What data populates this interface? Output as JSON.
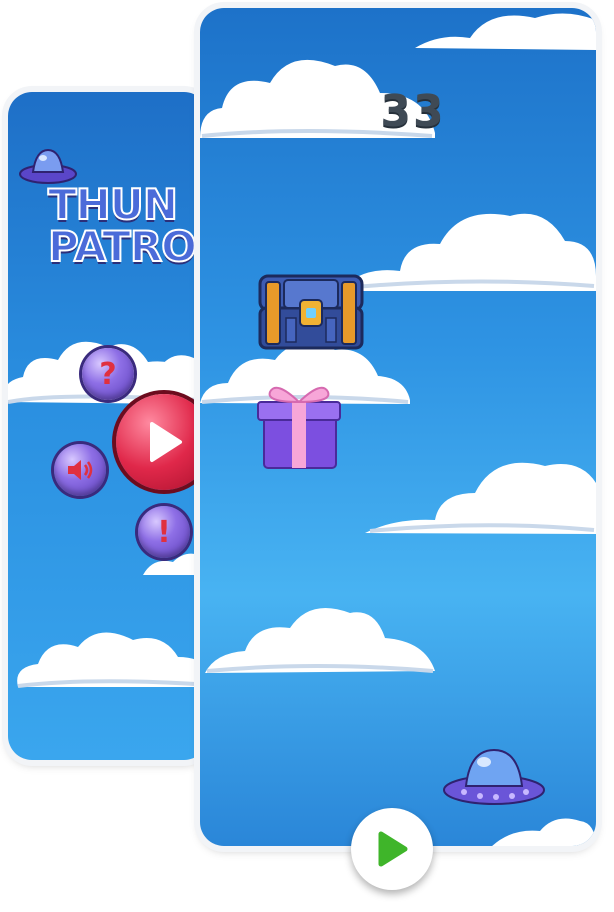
{
  "game": {
    "title_line1": "THUN",
    "title_line2": "PATRO",
    "score": "33"
  },
  "menu": {
    "help_icon": "question-icon",
    "sound_icon": "speaker-icon",
    "info_icon": "exclamation-icon",
    "play_icon": "play-icon"
  },
  "colors": {
    "sky_top": "#1d72c9",
    "sky_mid": "#48b3f2",
    "play_button_red": "#e0284a",
    "bubble_purple": "#8e6fe6",
    "play_arrow_green": "#3fb52a",
    "score_text": "#3f4a55"
  }
}
